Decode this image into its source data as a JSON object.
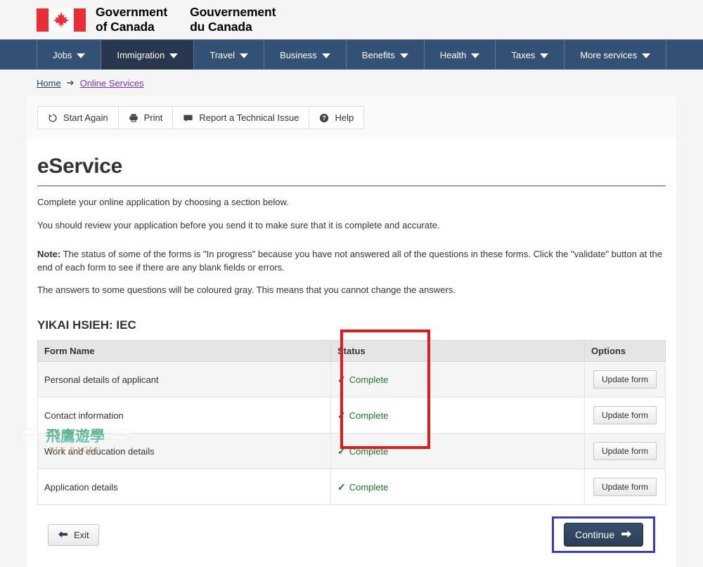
{
  "header": {
    "flag_alt": "canada-flag",
    "wordmark_en_line1": "Government",
    "wordmark_en_line2": "of Canada",
    "wordmark_fr_line1": "Gouvernement",
    "wordmark_fr_line2": "du Canada"
  },
  "nav": {
    "items": [
      {
        "label": "Jobs",
        "active": false
      },
      {
        "label": "Immigration",
        "active": true
      },
      {
        "label": "Travel",
        "active": false
      },
      {
        "label": "Business",
        "active": false
      },
      {
        "label": "Benefits",
        "active": false
      },
      {
        "label": "Health",
        "active": false
      },
      {
        "label": "Taxes",
        "active": false
      },
      {
        "label": "More services",
        "active": false
      }
    ],
    "background": "#335075",
    "active_background": "#28374e"
  },
  "breadcrumb": {
    "home": "Home",
    "separator": "➔",
    "current": "Online Services",
    "home_color": "#284162",
    "current_color": "#7834bc"
  },
  "toolbar": {
    "start_again": "Start Again",
    "print": "Print",
    "report_issue": "Report a Technical Issue",
    "help": "Help"
  },
  "main": {
    "title": "eService",
    "title_rule_color": "#af3c43",
    "intro": "Complete your online application by choosing a section below.",
    "review": "You should review your application before you send it to make sure that it is complete and accurate.",
    "note_label": "Note:",
    "note_body": " The status of some of the forms is \"In progress\" because you have not answered all of the questions in these forms. Click the \"validate\" button at the end of each form to see if there are any blank fields or errors.",
    "gray_note": "The answers to some questions will be coloured gray. This means that you cannot change the answers.",
    "section_title": "YIKAI HSIEH: IEC"
  },
  "table": {
    "headers": [
      "Form Name",
      "Status",
      "Options"
    ],
    "rows": [
      {
        "form_name": "Personal details of applicant",
        "status": "Complete",
        "status_icon": "✓",
        "option": "Update form"
      },
      {
        "form_name": "Contact information",
        "status": "Complete",
        "status_icon": "✓",
        "option": "Update form"
      },
      {
        "form_name": "Work and education details",
        "status": "Complete",
        "status_icon": "✓",
        "option": "Update form"
      },
      {
        "form_name": "Application details",
        "status": "Complete",
        "status_icon": "✓",
        "option": "Update form"
      }
    ],
    "status_color": "#1a7a2c"
  },
  "footer": {
    "exit": "Exit",
    "continue": "Continue"
  },
  "annotations": {
    "status_box_color": "#e01b1b",
    "continue_box_color": "#3b3bc4"
  },
  "watermark": {
    "chinese": "飛鷹遊學",
    "latin": "FLY EAGLE"
  }
}
